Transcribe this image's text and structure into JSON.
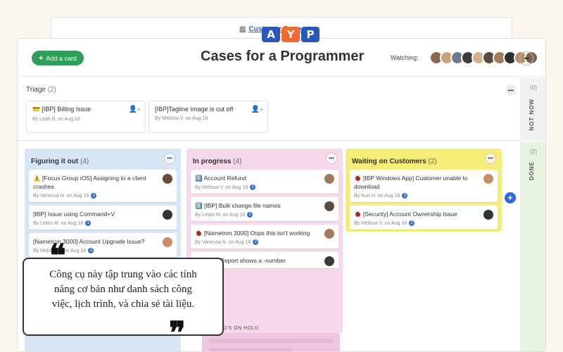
{
  "back": {
    "link": "Customer Support"
  },
  "logo": [
    "A",
    "Y",
    "P"
  ],
  "header": {
    "add_card_label": "Add a card",
    "title": "Cases for a Programmer",
    "watching_label": "Watching:",
    "more_label": "•••"
  },
  "colors": {
    "green": "#2f9e58",
    "blue_col": "#d7e6f5",
    "pink_col": "#f7d7ea",
    "yellow_col": "#f6ec79",
    "done_col": "#e8f3e1"
  },
  "triage": {
    "title": "Triage",
    "count": "(2)",
    "cards": [
      {
        "name": "[IBP] Billing Issue",
        "by": "By Leah B. on Aug 18",
        "icon": "card-icon"
      },
      {
        "name": "[IBP]Tagline Image is cut off",
        "by": "By Melissa V. on Aug 18"
      }
    ]
  },
  "side": {
    "not_now_count": "(0)",
    "not_now_label": "NOT NOW",
    "done_count": "(2)",
    "done_label": "DONE"
  },
  "columns": [
    {
      "title": "Figuring it out",
      "count": "(4)",
      "tasks": [
        {
          "name": "⚠️ [Focus Group iOS] Assigning to a client crashes",
          "by": "By Vanessa N. on Aug 18",
          "badge": "1"
        },
        {
          "name": "[IBP] Issue using Command+V",
          "by": "By Lewis M. on Aug 18",
          "badge": "1"
        },
        {
          "name": "[Nametron 3000] Account Upgrade Issue?",
          "by": "By Melissa V. on Aug 18",
          "badge": "1"
        }
      ]
    },
    {
      "title": "In progress",
      "count": "(4)",
      "tasks": [
        {
          "name": "1️⃣ Account Refund",
          "by": "By Melissa V. on Aug 18",
          "badge": "1"
        },
        {
          "name": "2️⃣ [IBP] Bulk change file names",
          "by": "By Lewis M. on Aug 18",
          "badge": "1"
        },
        {
          "name": "🐞 [Nametron 3000] Oops this isn't working",
          "by": "By Vanessa N. on Aug 18",
          "badge": "2"
        },
        {
          "name": "[eGADS] Report shows a -number",
          "by": "",
          "badge": ""
        }
      ],
      "hold_label": "NOTHING'S ON HOLD"
    },
    {
      "title": "Waiting on Customers",
      "count": "(2)",
      "tasks": [
        {
          "name": "🐞 [IBP Windows App] Customer unable to download",
          "by": "By Kurt H. on Aug 18",
          "badge": "2"
        },
        {
          "name": "🐞 [Security] Account Ownership Issue",
          "by": "By Melissa V. on Aug 18",
          "badge": "2"
        }
      ]
    }
  ],
  "quote": {
    "open": "❝",
    "close": "❞",
    "text": "Công cụ này tập trung vào các tính năng cơ bản như danh sách công việc, lịch trình, và chia sẻ tài liệu."
  }
}
